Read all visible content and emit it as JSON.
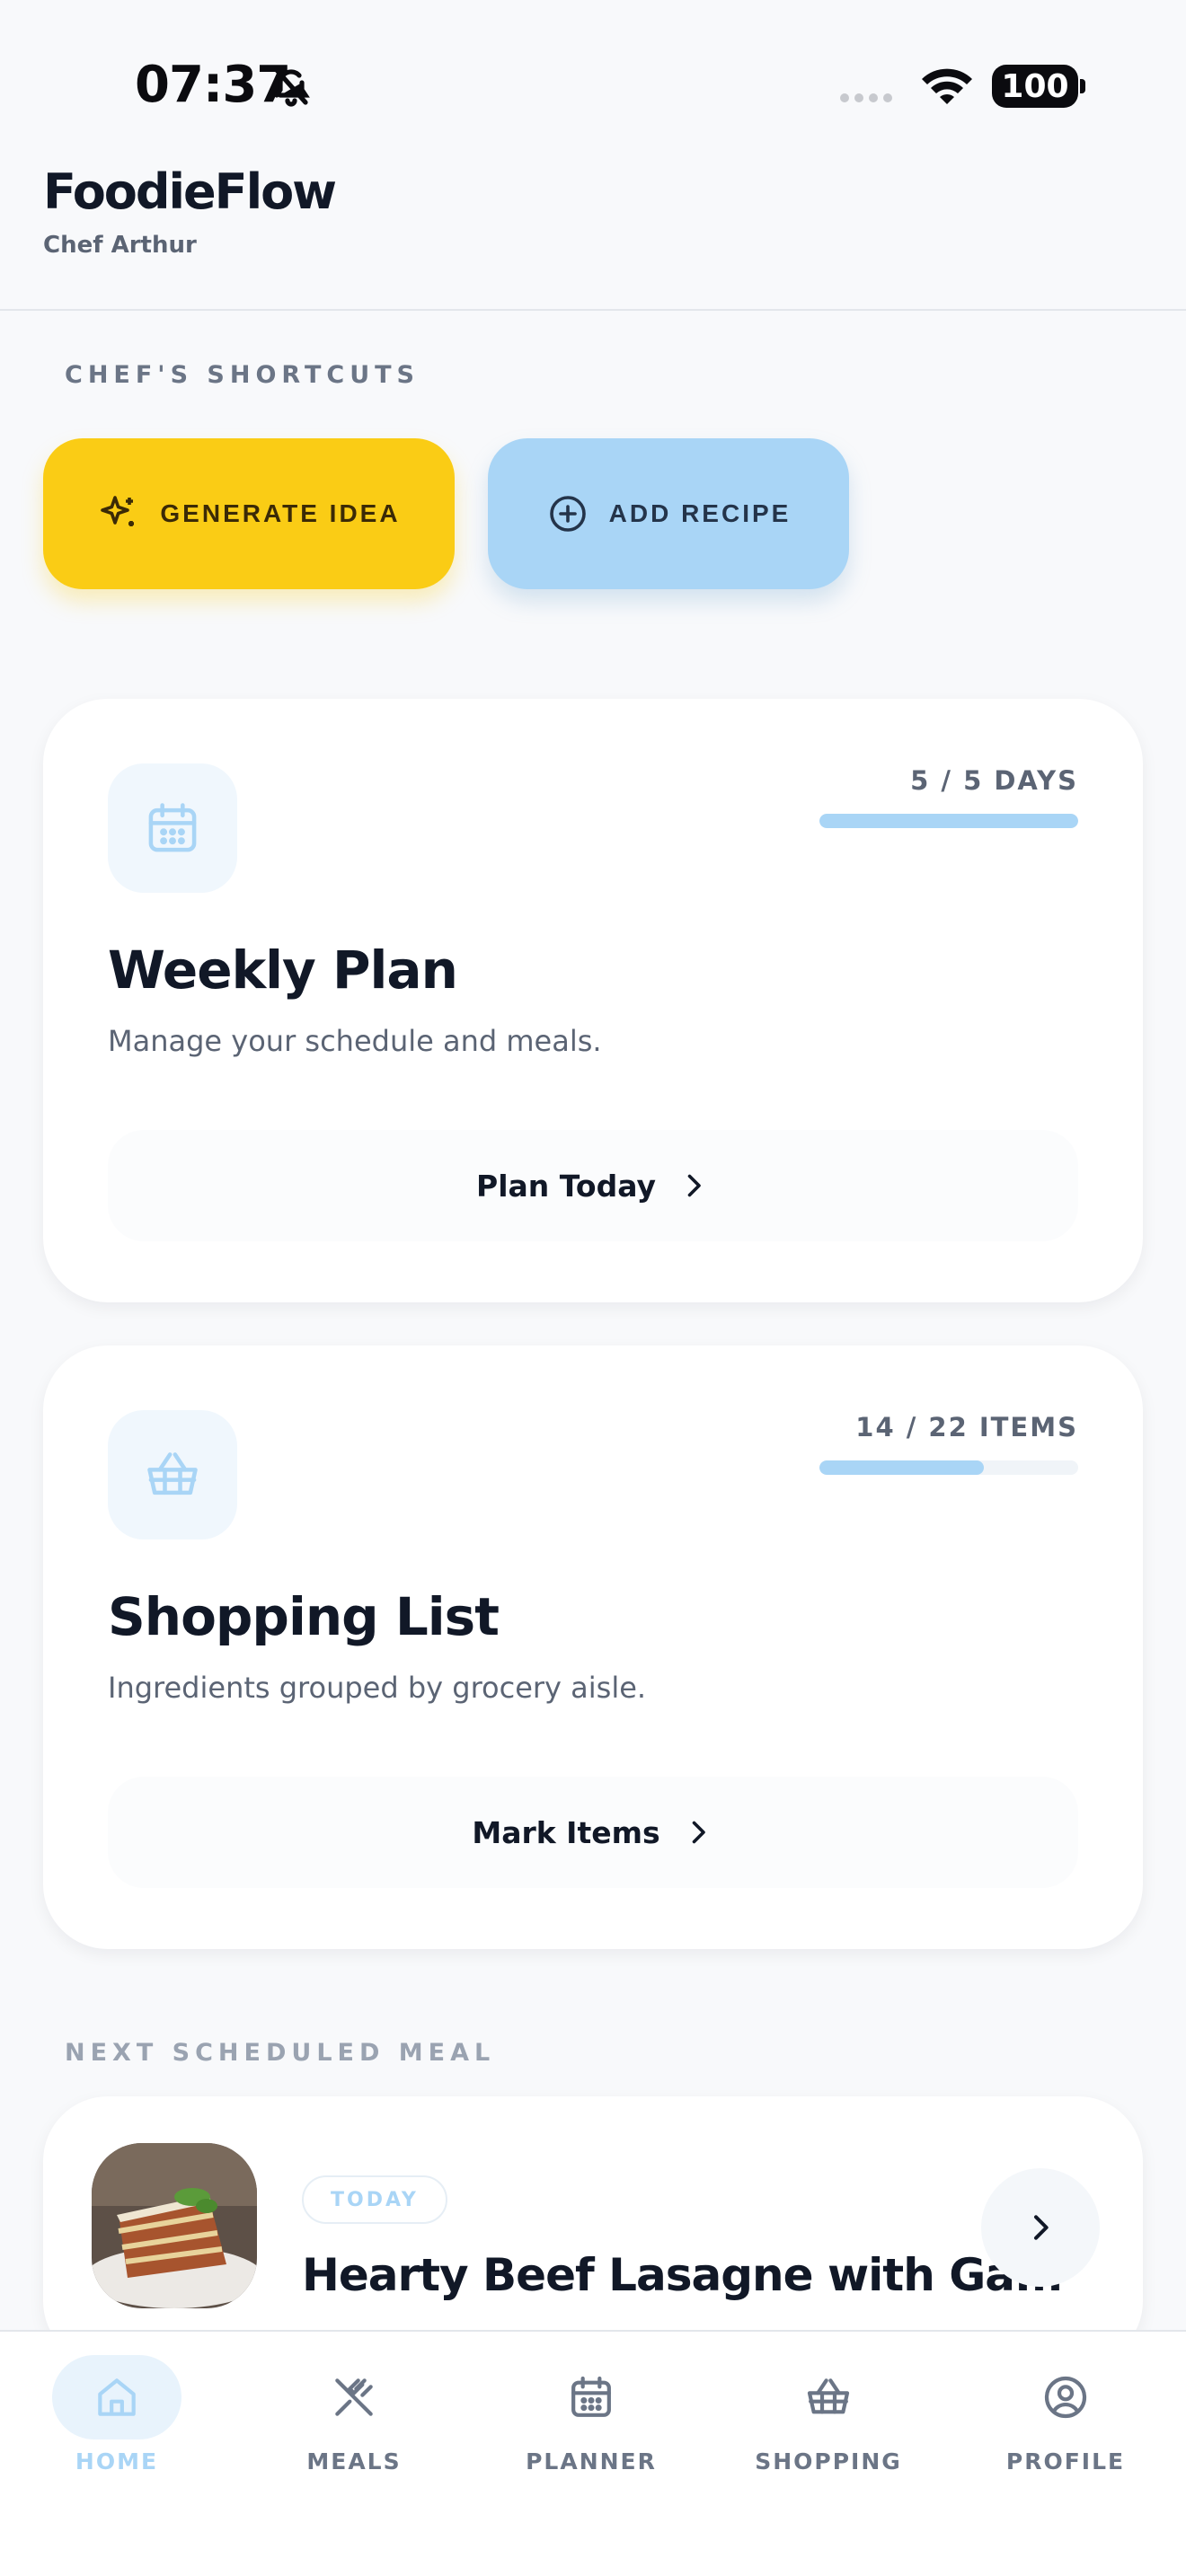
{
  "status_bar": {
    "time": "07:37",
    "battery": "100"
  },
  "header": {
    "title": "FoodieFlow",
    "subtitle": "Chef Arthur"
  },
  "shortcuts": {
    "label": "CHEF'S SHORTCUTS",
    "generate_label": "GENERATE IDEA",
    "add_label": "ADD RECIPE",
    "generate_color": "#facc15",
    "add_color": "#a9d5f6"
  },
  "weekly_plan": {
    "progress_text": "5 / 5 DAYS",
    "progress_fraction": 1.0,
    "title": "Weekly Plan",
    "description": "Manage your schedule and meals.",
    "action_label": "Plan Today",
    "icon": "calendar-icon"
  },
  "shopping_list": {
    "progress_text": "14 / 22 ITEMS",
    "progress_fraction": 0.636,
    "title": "Shopping List",
    "description": "Ingredients grouped by grocery aisle.",
    "action_label": "Mark Items",
    "icon": "basket-icon"
  },
  "next_meal": {
    "label": "NEXT SCHEDULED MEAL",
    "badge": "TODAY",
    "title": "Hearty Beef Lasagne with Ga..."
  },
  "tabs": [
    {
      "label": "HOME",
      "icon": "home-icon",
      "active": true
    },
    {
      "label": "MEALS",
      "icon": "utensils-icon",
      "active": false
    },
    {
      "label": "PLANNER",
      "icon": "calendar-icon",
      "active": false
    },
    {
      "label": "SHOPPING",
      "icon": "basket-icon",
      "active": false
    },
    {
      "label": "PROFILE",
      "icon": "user-circle-icon",
      "active": false
    }
  ],
  "accent_color": "#a9d5f6"
}
